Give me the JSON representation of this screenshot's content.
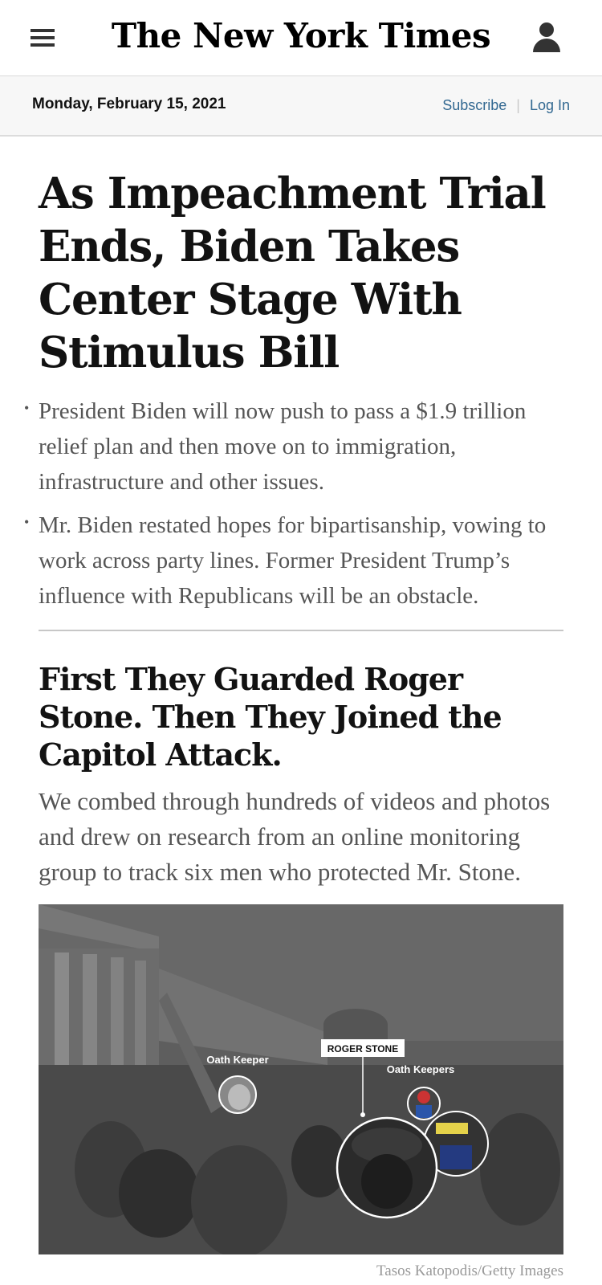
{
  "masthead": {
    "logo": "The New York Times"
  },
  "datebar": {
    "date": "Monday, February 15, 2021",
    "subscribe": "Subscribe",
    "login": "Log In"
  },
  "lead_story": {
    "headline": "As Impeachment Trial Ends, Biden Takes Center Stage With Stimulus Bill",
    "bullets": [
      "President Biden will now push to pass a $1.9 trillion relief plan and then move on to immigration, infrastructure and other issues.",
      "Mr. Biden restated hopes for bipartisanship, vowing to work across party lines. Former President Trump’s influence with Republicans will be an obstacle."
    ]
  },
  "second_story": {
    "headline": "First They Guarded Roger Stone. Then They Joined the Capitol Attack.",
    "summary": "We combed through hundreds of videos and photos and drew on research from an online monitoring group to track six men who protected Mr. Stone.",
    "image": {
      "labels": {
        "oath_keeper": "Oath Keeper",
        "roger_stone": "ROGER STONE",
        "oath_keepers": "Oath Keepers"
      },
      "credit": "Tasos Katopodis/Getty Images"
    }
  }
}
